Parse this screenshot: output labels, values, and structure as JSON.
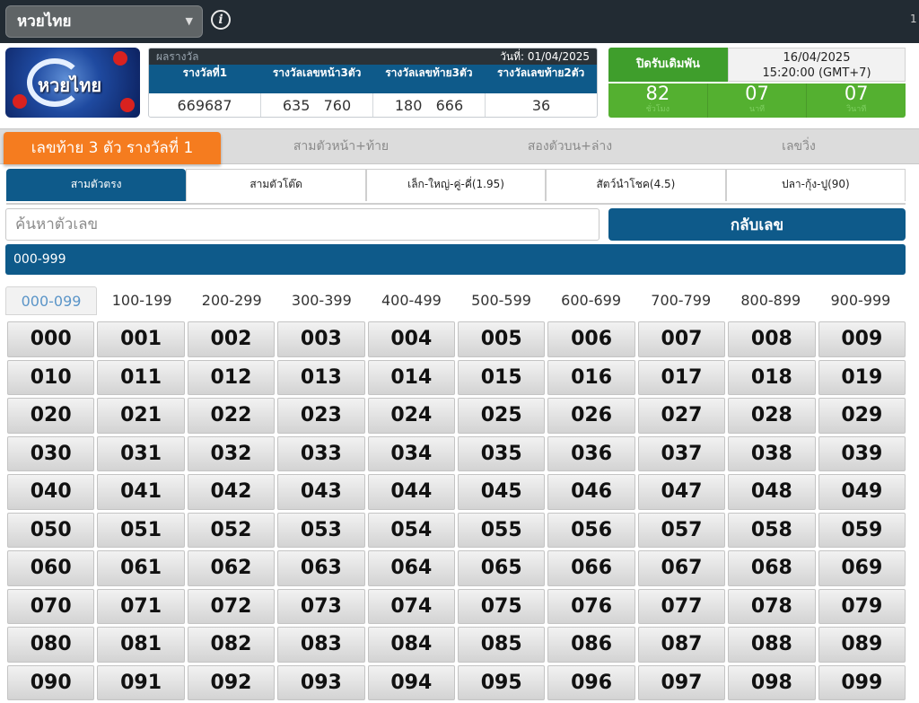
{
  "topbar": {
    "lottery_select": "หวยไทย",
    "info_icon": "info-circle-icon",
    "right_text": "1"
  },
  "logo": {
    "text": "หวยไทย"
  },
  "results": {
    "title": "ผลรางวัล",
    "date": "วันที่: 01/04/2025",
    "headers": [
      "รางวัลที่1",
      "รางวัลเลขหน้า3ตัว",
      "รางวัลเลขท้าย3ตัว",
      "รางวัลเลขท้าย2ตัว"
    ],
    "values": [
      "669687",
      "635   760",
      "180   666",
      "36"
    ]
  },
  "close": {
    "label": "ปิดรับเดิมพัน",
    "date": "16/04/2025",
    "time": "15:20:00 (GMT+7)",
    "countdown": [
      {
        "value": "82",
        "unit": "ชั่วโมง"
      },
      {
        "value": "07",
        "unit": "นาที"
      },
      {
        "value": "07",
        "unit": "วินาที"
      }
    ]
  },
  "category_tabs": [
    "เลขท้าย 3 ตัว รางวัลที่ 1",
    "สามตัวหน้า+ท้าย",
    "สองตัวบน+ล่าง",
    "เลขวิ่ง"
  ],
  "sub_tabs": [
    "สามตัวตรง",
    "สามตัวโต๊ด",
    "เล็ก-ใหญ่-คู่-คี่(1.95)",
    "สัตว์นำโชค(4.5)",
    "ปลา-กุ้ง-ปู(90)"
  ],
  "search": {
    "placeholder": "ค้นหาตัวเลข",
    "flip_button": "กลับเลข"
  },
  "range_bar": "000-999",
  "range_tabs": [
    "000-099",
    "100-199",
    "200-299",
    "300-399",
    "400-499",
    "500-599",
    "600-699",
    "700-799",
    "800-899",
    "900-999"
  ],
  "numbers": [
    "000",
    "001",
    "002",
    "003",
    "004",
    "005",
    "006",
    "007",
    "008",
    "009",
    "010",
    "011",
    "012",
    "013",
    "014",
    "015",
    "016",
    "017",
    "018",
    "019",
    "020",
    "021",
    "022",
    "023",
    "024",
    "025",
    "026",
    "027",
    "028",
    "029",
    "030",
    "031",
    "032",
    "033",
    "034",
    "035",
    "036",
    "037",
    "038",
    "039",
    "040",
    "041",
    "042",
    "043",
    "044",
    "045",
    "046",
    "047",
    "048",
    "049",
    "050",
    "051",
    "052",
    "053",
    "054",
    "055",
    "056",
    "057",
    "058",
    "059",
    "060",
    "061",
    "062",
    "063",
    "064",
    "065",
    "066",
    "067",
    "068",
    "069",
    "070",
    "071",
    "072",
    "073",
    "074",
    "075",
    "076",
    "077",
    "078",
    "079",
    "080",
    "081",
    "082",
    "083",
    "084",
    "085",
    "086",
    "087",
    "088",
    "089",
    "090",
    "091",
    "092",
    "093",
    "094",
    "095",
    "096",
    "097",
    "098",
    "099"
  ],
  "colors": {
    "primary": "#0e5a8a",
    "accent_orange": "#f57c1f",
    "green": "#54b030",
    "topbar": "#222b33"
  }
}
